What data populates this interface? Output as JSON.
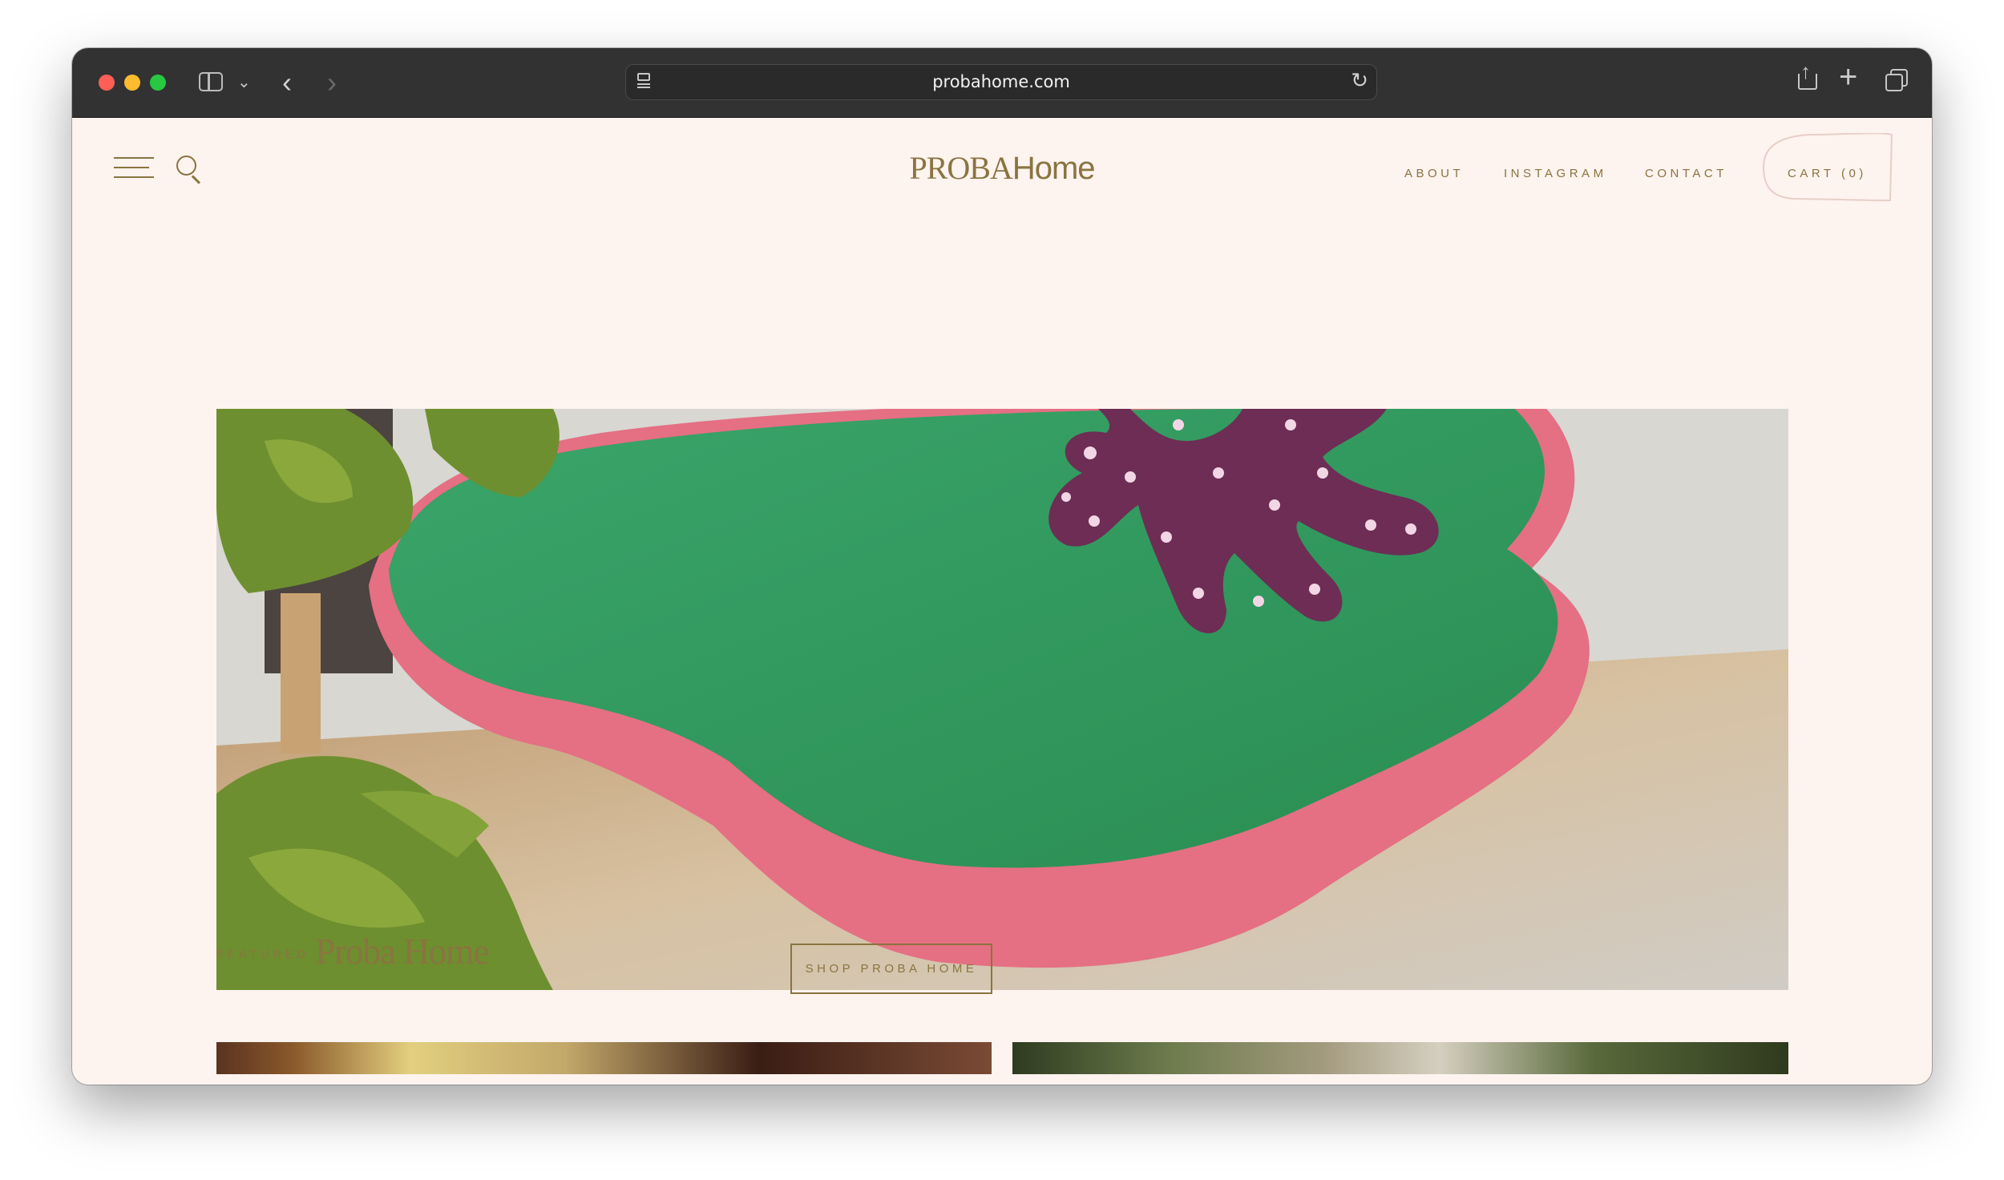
{
  "browser": {
    "url": "probahome.com"
  },
  "header": {
    "logo_part1": "PROBA",
    "logo_part2": "Home",
    "nav": {
      "about": "ABOUT",
      "instagram": "INSTAGRAM",
      "contact": "CONTACT",
      "cart": "CART (0)"
    }
  },
  "featured": {
    "kicker": "FEATURED",
    "title": "Proba Home",
    "button": "SHOP PROBA HOME"
  },
  "colors": {
    "background": "#fdf3ef",
    "brand": "#8a7440",
    "cushion_green": "#2f9a5c",
    "cushion_pink": "#e46f84",
    "ornament_purple": "#6e2e55"
  }
}
